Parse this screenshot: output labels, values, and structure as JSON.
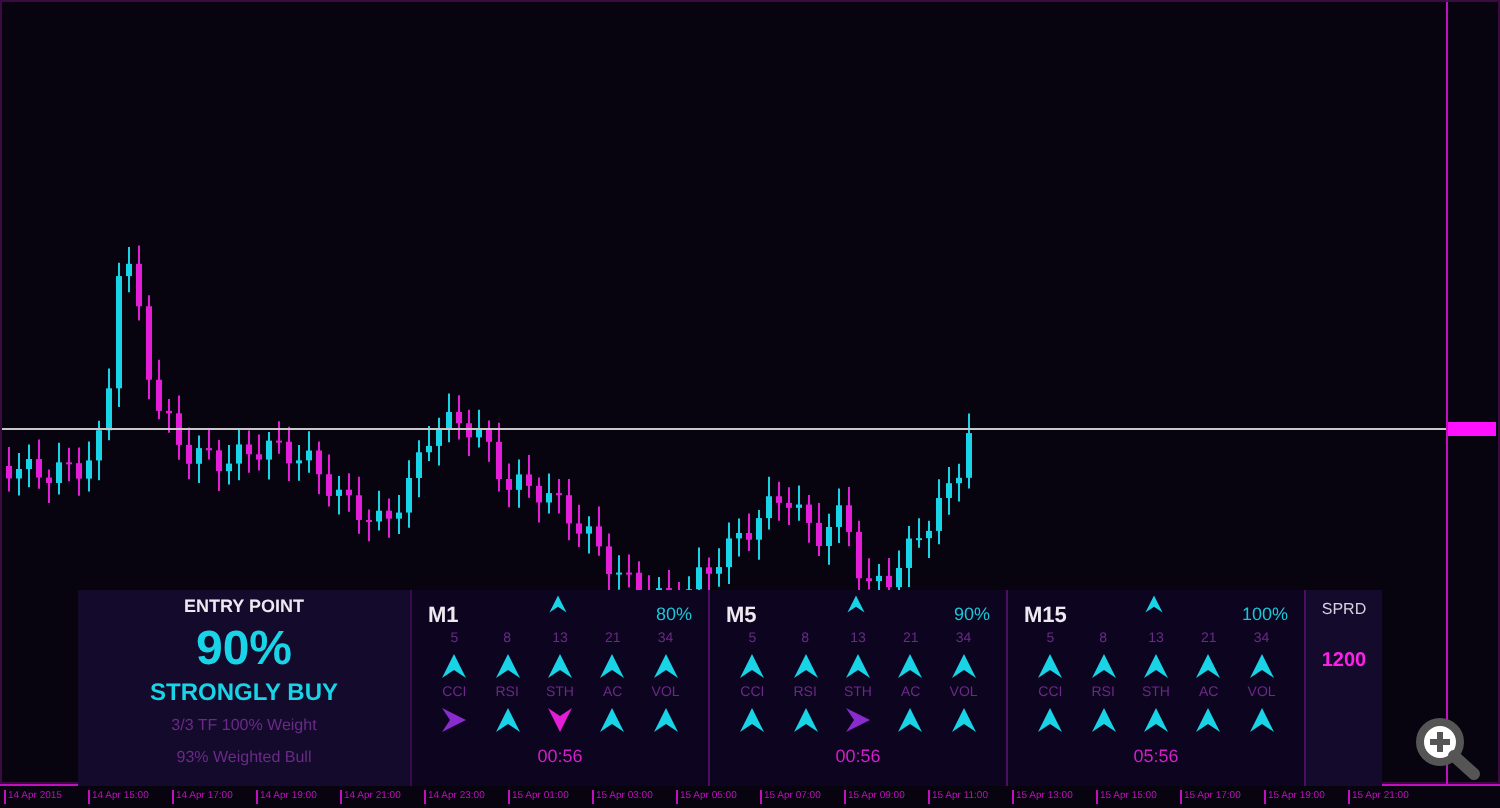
{
  "time_axis": {
    "labels": [
      "14 Apr 2015",
      "14 Apr 15:00",
      "14 Apr 17:00",
      "14 Apr 19:00",
      "14 Apr 21:00",
      "14 Apr 23:00",
      "15 Apr 01:00",
      "15 Apr 03:00",
      "15 Apr 05:00",
      "15 Apr 07:00",
      "15 Apr 09:00",
      "15 Apr 11:00",
      "15 Apr 13:00",
      "15 Apr 15:00",
      "15 Apr 17:00",
      "15 Apr 19:00",
      "15 Apr 21:00"
    ]
  },
  "entry": {
    "title": "ENTRY POINT",
    "percent": "90%",
    "signal": "STRONGLY BUY",
    "weight": "3/3 TF 100% Weight",
    "bull": "93% Weighted Bull"
  },
  "timeframes": [
    {
      "name": "M1",
      "trend": {
        "kind": "up"
      },
      "percent": "80%",
      "periods": [
        "5",
        "8",
        "13",
        "21",
        "34"
      ],
      "period_arrows": [
        {
          "kind": "up"
        },
        {
          "kind": "up"
        },
        {
          "kind": "up"
        },
        {
          "kind": "up"
        },
        {
          "kind": "up"
        }
      ],
      "indicators": [
        "CCI",
        "RSI",
        "STH",
        "AC",
        "VOL"
      ],
      "indicator_arrows": [
        {
          "kind": "right"
        },
        {
          "kind": "up"
        },
        {
          "kind": "down"
        },
        {
          "kind": "up"
        },
        {
          "kind": "up"
        }
      ],
      "timer": "00:56"
    },
    {
      "name": "M5",
      "trend": {
        "kind": "up"
      },
      "percent": "90%",
      "periods": [
        "5",
        "8",
        "13",
        "21",
        "34"
      ],
      "period_arrows": [
        {
          "kind": "up"
        },
        {
          "kind": "up"
        },
        {
          "kind": "up"
        },
        {
          "kind": "up"
        },
        {
          "kind": "up"
        }
      ],
      "indicators": [
        "CCI",
        "RSI",
        "STH",
        "AC",
        "VOL"
      ],
      "indicator_arrows": [
        {
          "kind": "up"
        },
        {
          "kind": "up"
        },
        {
          "kind": "right"
        },
        {
          "kind": "up"
        },
        {
          "kind": "up"
        }
      ],
      "timer": "00:56"
    },
    {
      "name": "M15",
      "trend": {
        "kind": "up"
      },
      "percent": "100%",
      "periods": [
        "5",
        "8",
        "13",
        "21",
        "34"
      ],
      "period_arrows": [
        {
          "kind": "up"
        },
        {
          "kind": "up"
        },
        {
          "kind": "up"
        },
        {
          "kind": "up"
        },
        {
          "kind": "up"
        }
      ],
      "indicators": [
        "CCI",
        "RSI",
        "STH",
        "AC",
        "VOL"
      ],
      "indicator_arrows": [
        {
          "kind": "up"
        },
        {
          "kind": "up"
        },
        {
          "kind": "up"
        },
        {
          "kind": "up"
        },
        {
          "kind": "up"
        }
      ],
      "timer": "05:56"
    }
  ],
  "spread": {
    "label": "SPRD",
    "value": "1200"
  }
}
